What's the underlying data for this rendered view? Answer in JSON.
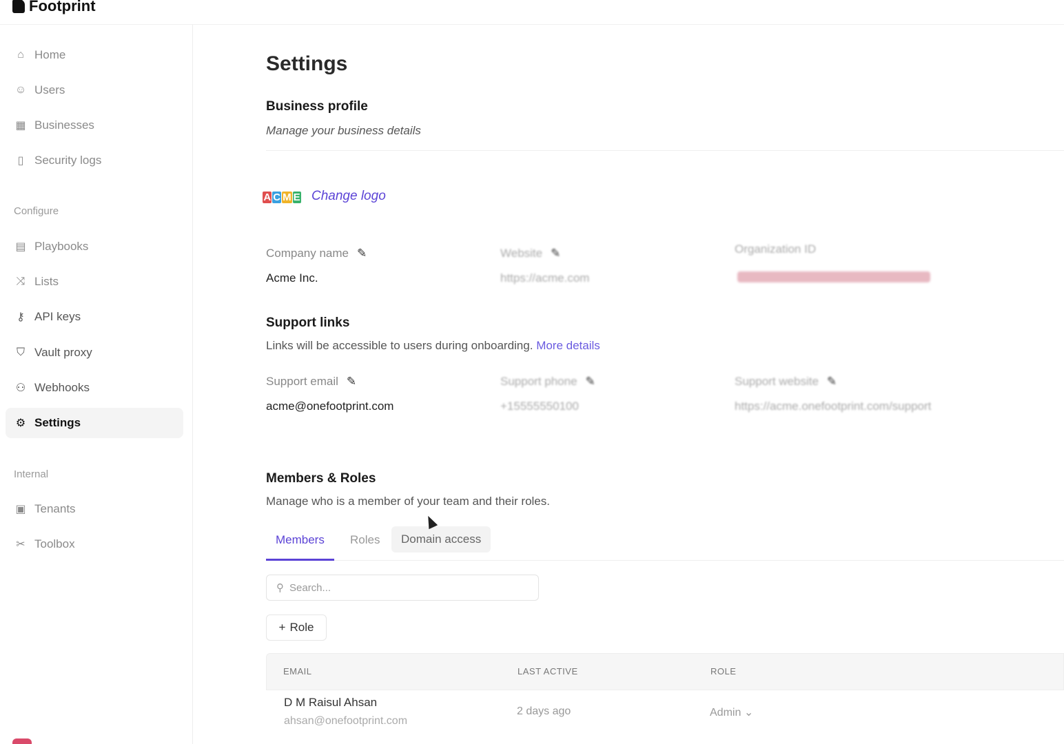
{
  "app": {
    "brand": "Footprint"
  },
  "sidebar": {
    "items": [
      {
        "label": "Home",
        "icon": "home-icon"
      },
      {
        "label": "Users",
        "icon": "users-icon"
      },
      {
        "label": "Businesses",
        "icon": "building-icon"
      },
      {
        "label": "Security logs",
        "icon": "file-icon"
      }
    ],
    "configure_label": "Configure",
    "configure_items": [
      {
        "label": "Playbooks",
        "icon": "book-icon"
      },
      {
        "label": "Lists",
        "icon": "shuffle-icon"
      },
      {
        "label": "API keys",
        "icon": "key-icon"
      },
      {
        "label": "Vault proxy",
        "icon": "shield-icon"
      },
      {
        "label": "Webhooks",
        "icon": "webhook-icon"
      },
      {
        "label": "Settings",
        "icon": "gear-icon",
        "active": true
      }
    ],
    "internal_label": "Internal",
    "internal_items": [
      {
        "label": "Tenants",
        "icon": "calendar-icon"
      },
      {
        "label": "Toolbox",
        "icon": "tools-icon"
      }
    ]
  },
  "page": {
    "title": "Settings",
    "business_profile": {
      "title": "Business profile",
      "subtitle": "Manage your business details",
      "logo_text": "ACME",
      "change_logo": "Change logo",
      "company_name_label": "Company name",
      "company_name_value": "Acme Inc.",
      "website_label": "Website",
      "website_value": "https://acme.com",
      "organization_label": "Organization ID"
    },
    "support_links": {
      "title": "Support links",
      "subtitle": "Links will be accessible to users during onboarding.",
      "more_details": "More details",
      "email_label": "Support email",
      "email_value": "acme@onefootprint.com",
      "phone_label": "Support phone",
      "phone_value": "+15555550100",
      "website_label": "Support website",
      "website_value": "https://acme.onefootprint.com/support"
    },
    "members_roles": {
      "title": "Members & Roles",
      "subtitle": "Manage who is a member of your team and their roles.",
      "tabs": [
        "Members",
        "Roles",
        "Domain access"
      ],
      "search_placeholder": "Search...",
      "add_role": "Role",
      "columns": [
        "EMAIL",
        "LAST ACTIVE",
        "ROLE"
      ],
      "rows": [
        {
          "name": "D M Raisul Ahsan",
          "email": "ahsan@onefootprint.com",
          "last_active": "2 days ago",
          "role": "Admin"
        }
      ]
    }
  },
  "colors": {
    "accent": "#5b43d6",
    "active_bg": "#f4f4f4"
  }
}
